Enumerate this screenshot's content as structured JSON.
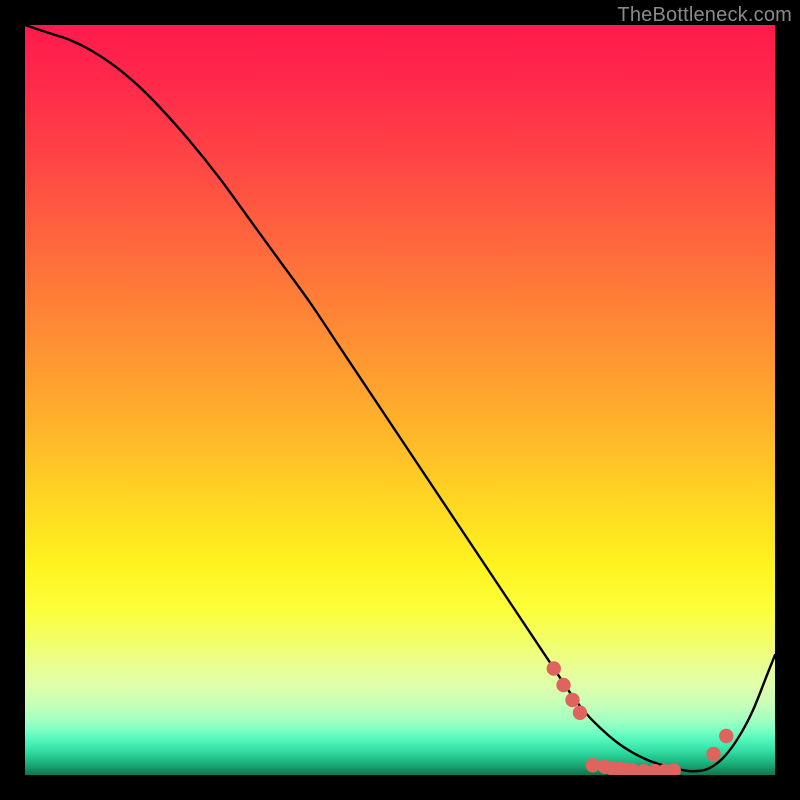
{
  "watermark": "TheBottleneck.com",
  "colors": {
    "curve_stroke": "#000000",
    "marker_fill": "#e0645e",
    "marker_stroke": "#e0645e"
  },
  "chart_data": {
    "type": "line",
    "title": "",
    "xlabel": "",
    "ylabel": "",
    "xlim": [
      0,
      100
    ],
    "ylim": [
      0,
      100
    ],
    "series": [
      {
        "name": "curve",
        "x": [
          0,
          3,
          6,
          9,
          12,
          15,
          18,
          22,
          26,
          30,
          34,
          38,
          42,
          46,
          50,
          54,
          58,
          62,
          66,
          70,
          73,
          75,
          77,
          79,
          81,
          83,
          85,
          87,
          89,
          91,
          93,
          95,
          97,
          99,
          100
        ],
        "y": [
          100,
          99,
          98,
          96.5,
          94.5,
          92,
          89,
          84.5,
          79.5,
          74,
          68.5,
          63,
          57,
          51,
          45,
          39,
          33,
          27,
          21,
          15,
          10.5,
          8,
          6,
          4.3,
          3,
          2,
          1.3,
          0.8,
          0.5,
          0.8,
          2.2,
          4.8,
          8.5,
          13.5,
          16
        ]
      }
    ],
    "markers": [
      {
        "x": 70.5,
        "y": 14.2
      },
      {
        "x": 71.8,
        "y": 12.0
      },
      {
        "x": 73.0,
        "y": 10.0
      },
      {
        "x": 74.0,
        "y": 8.3
      },
      {
        "x": 75.7,
        "y": 1.3
      },
      {
        "x": 77.3,
        "y": 1.1
      },
      {
        "x": 78.3,
        "y": 0.9
      },
      {
        "x": 79.3,
        "y": 0.8
      },
      {
        "x": 80.2,
        "y": 0.7
      },
      {
        "x": 81.0,
        "y": 0.6
      },
      {
        "x": 82.5,
        "y": 0.5
      },
      {
        "x": 84.0,
        "y": 0.5
      },
      {
        "x": 85.3,
        "y": 0.5
      },
      {
        "x": 86.5,
        "y": 0.6
      },
      {
        "x": 91.8,
        "y": 2.8
      },
      {
        "x": 93.5,
        "y": 5.2
      }
    ]
  }
}
